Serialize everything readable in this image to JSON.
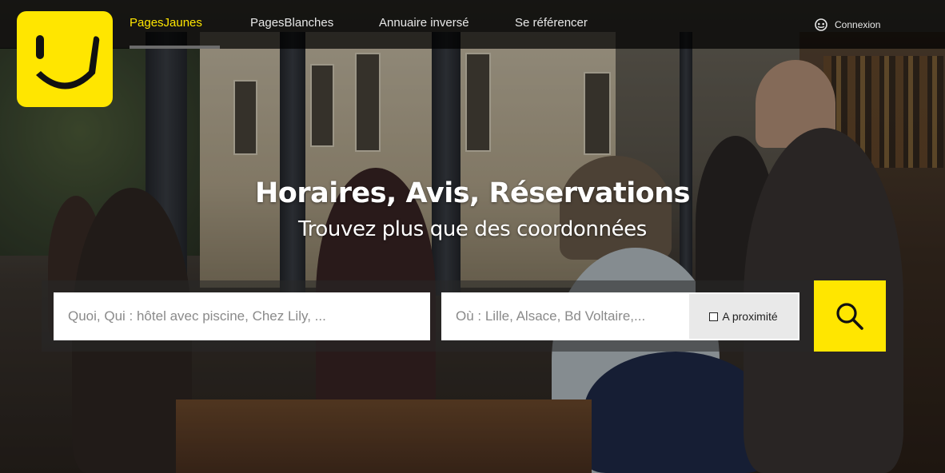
{
  "nav": {
    "items": [
      {
        "label": "PagesJaunes",
        "active": true
      },
      {
        "label": "PagesBlanches",
        "active": false
      },
      {
        "label": "Annuaire inversé",
        "active": false
      },
      {
        "label": "Se référencer",
        "active": false
      }
    ],
    "login_label": "Connexion",
    "login_icon": "user-circle-icon"
  },
  "logo": {
    "icon": "smiley-logo",
    "color": "#ffe600"
  },
  "hero": {
    "headline": "Horaires, Avis, Réservations",
    "subline": "Trouvez plus que des coordonnées"
  },
  "search": {
    "what_placeholder": "Quoi, Qui : hôtel avec piscine, Chez Lily, ...",
    "what_value": "",
    "where_placeholder": "Où : Lille, Alsace, Bd Voltaire,...",
    "where_value": "",
    "proximity_label": "A proximité",
    "proximity_checked": false,
    "button_icon": "search-icon"
  },
  "colors": {
    "brand_yellow": "#ffe600",
    "nav_background": "#000000",
    "text_white": "#ffffff"
  }
}
